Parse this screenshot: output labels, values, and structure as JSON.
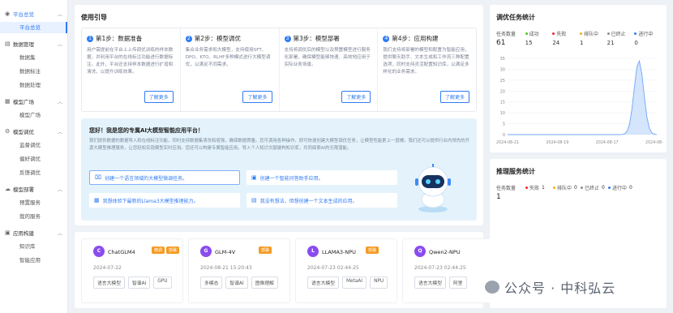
{
  "sidebar": {
    "groups": [
      {
        "label": "平台总览",
        "items": [
          "平台总览"
        ]
      },
      {
        "label": "数据管理",
        "items": [
          "数据集",
          "数据标注",
          "数据处理"
        ]
      },
      {
        "label": "模型广场",
        "items": [
          "模型广场"
        ]
      },
      {
        "label": "模型调优",
        "items": [
          "监督调优",
          "偏好调优",
          "反馈调优"
        ]
      },
      {
        "label": "模型部署",
        "items": [
          "预置服务",
          "我的服务"
        ]
      },
      {
        "label": "应用构建",
        "items": [
          "知识库",
          "智能应用"
        ]
      }
    ]
  },
  "guide": {
    "title": "使用引导",
    "steps": [
      {
        "num": "1",
        "title": "第1步：数据准备",
        "desc": "用户需提前在平台上上传调优训练的样本数据，并利用平台的在线标注功能进行数据标注。此外，平台还支持样本数据进行扩增和清洗，以提升训练效果。",
        "btn": "了解更多"
      },
      {
        "num": "2",
        "title": "第2步：模型调优",
        "desc": "集合业务需求和大模型，支持使用SFT、DPO、KTO、RLHF多种模式进行大模型调优，以满足不同需求。",
        "btn": "了解更多"
      },
      {
        "num": "3",
        "title": "第3步：模型部署",
        "desc": "支持将调优后的模型以及预置模型进行服务化部署，确保模型能够快速、高效地应用于实际业务场景。",
        "btn": "了解更多"
      },
      {
        "num": "4",
        "title": "第4步：应用构建",
        "desc": "我们支持将部署的模型和配置为智能应用，提供聊天助手、文本生成和工作流三种配置选项，同时支持灵活配置知识库，以满足多样化的业务需求。",
        "btn": "了解更多"
      }
    ]
  },
  "assistant": {
    "title": "您好！我是您的专属AI大模型智能应用平台！",
    "desc": "我们提供数据的数据导入和在线标注功能，同时支持数据集清洗和增强，确保数据质量。您可调用各种操作，即可快速创建大模型调优任务，让模型性能更上一层楼。我们还可以提供行业内领先的开源大模型推理服务，让您轻松实现模型实时应用。您还可以构建专属智能应用，导入个人知识文献建构知识库，共同探索AI的无限潜能。",
    "suggestions": [
      {
        "icon": "⌧",
        "text": "创建一个语言领域的大模型微调任务。"
      },
      {
        "icon": "▣",
        "text": "创建一个智能问答助手应用。"
      },
      {
        "icon": "▦",
        "text": "我想体验下最新的Llama3大模型推理能力。"
      },
      {
        "icon": "▤",
        "text": "我没有想法，但想创建一个文本生成的应用。"
      }
    ]
  },
  "models": [
    {
      "avatar": "C",
      "name": "ChatGLM4",
      "badges": [
        {
          "text": "微调",
          "color": "#f59a23"
        },
        {
          "text": "部署",
          "color": "#f59a23"
        }
      ],
      "date": "2024-07-22",
      "tags": [
        "语言大模型",
        "智谱AI",
        "GPU"
      ]
    },
    {
      "avatar": "G",
      "name": "GLM-4V",
      "badges": [
        {
          "text": "部署",
          "color": "#f59a23"
        }
      ],
      "date": "2024-08-21 15:20:43",
      "tags": [
        "多模态",
        "智谱AI",
        "图像理解"
      ]
    },
    {
      "avatar": "L",
      "name": "LLAMA3-NPU",
      "badges": [
        {
          "text": "部署",
          "color": "#f59a23"
        }
      ],
      "date": "2024-07-23 02:44:25",
      "tags": [
        "语言大模型",
        "MetaAI",
        "NPU"
      ]
    },
    {
      "avatar": "Q",
      "name": "Qwen2-NPU",
      "badges": [],
      "date": "2024-07-23 02:44:25",
      "tags": [
        "语言大模型",
        "阿里"
      ]
    }
  ],
  "tune_stats": {
    "title": "调优任务统计",
    "count_label": "任务数量",
    "total": "61",
    "statuses": [
      {
        "label": "成功",
        "color": "#52c41a",
        "value": "15"
      },
      {
        "label": "失败",
        "color": "#f5222d",
        "value": "24"
      },
      {
        "label": "排队中",
        "color": "#faad14",
        "value": "1"
      },
      {
        "label": "已终止",
        "color": "#8c8c8c",
        "value": "21"
      },
      {
        "label": "进行中",
        "color": "#2f7bf5",
        "value": "0"
      }
    ]
  },
  "chart_data": {
    "type": "area",
    "x": [
      "2024-08-21",
      "2024-08-19",
      "2024-08-17",
      "2024-08-15"
    ],
    "values": [
      0,
      0,
      0,
      34
    ],
    "ylim": [
      0,
      35
    ],
    "yticks": [
      0,
      5,
      10,
      15,
      20,
      25,
      30,
      35
    ],
    "xticks": [
      "2024-08-21",
      "2024-08-19",
      "2024-08-17",
      "2024-08-15"
    ],
    "grid": true
  },
  "infer_stats": {
    "title": "推理服务统计",
    "count_label": "任务数量",
    "total": "1",
    "statuses": [
      {
        "label": "失败",
        "color": "#f5222d",
        "value": "1"
      },
      {
        "label": "排队中",
        "color": "#faad14",
        "value": "0"
      },
      {
        "label": "已终止",
        "color": "#8c8c8c",
        "value": "0"
      },
      {
        "label": "进行中",
        "color": "#2f7bf5",
        "value": "0"
      }
    ]
  },
  "watermark": "公众号 · 中科弘云"
}
